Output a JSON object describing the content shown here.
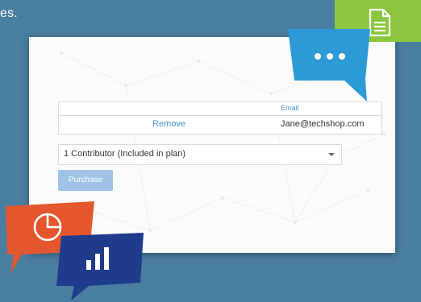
{
  "header": {
    "partial_text": "es."
  },
  "table": {
    "column_email": "Email",
    "rows": [
      {
        "action": "Remove",
        "email": "Jane@techshop.com"
      }
    ]
  },
  "contributor_select": {
    "value": "1 Contributor (Included in plan)"
  },
  "purchase_button": {
    "label": "Purchase"
  },
  "icons": [
    "document-icon",
    "chat-dots-icon",
    "pie-chart-icon",
    "bar-chart-icon"
  ],
  "colors": {
    "background": "#4a7ea1",
    "green": "#8cc63f",
    "blue": "#2d9ad6",
    "orange": "#e4572e",
    "navy": "#1f3b8c",
    "link": "#4a90c8"
  }
}
